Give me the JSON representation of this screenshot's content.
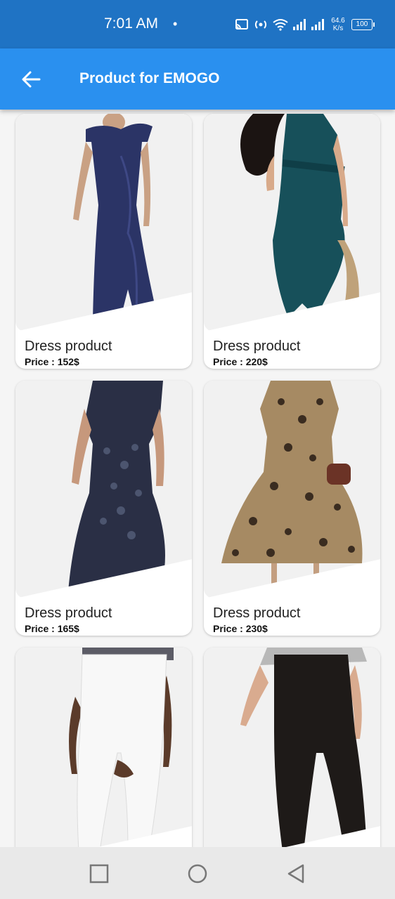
{
  "status_bar": {
    "time": "7:01 AM",
    "dot": "•",
    "speed_value": "64.6",
    "speed_unit": "K/s",
    "battery": "100"
  },
  "app_bar": {
    "title": "Product for EMOGO",
    "back_icon": "arrow-left-icon"
  },
  "products": [
    {
      "name": "Dress product",
      "price": "Price : 152$",
      "image": "navy-gown"
    },
    {
      "name": "Dress product",
      "price": "Price : 220$",
      "image": "teal-wrap-dress"
    },
    {
      "name": "Dress product",
      "price": "Price : 165$",
      "image": "beaded-navy-gown"
    },
    {
      "name": "Dress product",
      "price": "Price : 230$",
      "image": "leopard-midi-dress"
    },
    {
      "name": "",
      "price": "",
      "image": "white-jeans"
    },
    {
      "name": "",
      "price": "",
      "image": "black-leggings"
    }
  ],
  "nav_bar": {
    "recent_icon": "square-icon",
    "home_icon": "circle-icon",
    "back_icon": "triangle-back-icon"
  },
  "colors": {
    "status_bar": "#1f73c4",
    "app_bar": "#2a90ef",
    "background": "#f5f5f5"
  }
}
